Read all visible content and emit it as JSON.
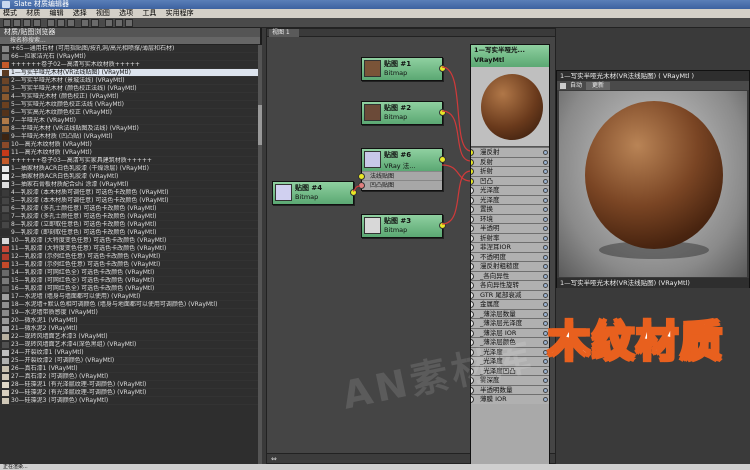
{
  "title": "Slate 材质编辑器",
  "menu": [
    "模式",
    "材质",
    "编辑",
    "选择",
    "视图",
    "选项",
    "工具",
    "实用程序"
  ],
  "browser": {
    "header": "材质/贴图浏览器",
    "search_placeholder": "按名称搜索...",
    "items": [
      {
        "label": "+65—通用石材 (可用指贴图/按孔洞/高光相喷撑/薄层和石材)",
        "color": "#888888"
      },
      {
        "label": "66—拉家洁光石 (VRayMtl)",
        "color": "#777777"
      },
      {
        "label": "++++++卷子02—高清写实木纹材质+++++",
        "color": "#c45a2a"
      },
      {
        "label": "1—写实半哑光木材(VR法线贴图) (VRayMtl)",
        "color": "#5a3a22"
      },
      {
        "label": "2—写实半哑光木材 (景城法线) (VRayMtl)",
        "color": "#6b4427"
      },
      {
        "label": "3—写实半哑光木材 (颜色校正法线) (VRayMtl)",
        "color": "#7a4d2a"
      },
      {
        "label": "4—写实哑光木材 (颜色校正) (VRayMtl)",
        "color": "#8a5a30"
      },
      {
        "label": "5—写实哑光木纹颜色校正法线 (VRayMtl)",
        "color": "#6a4020"
      },
      {
        "label": "6—写实高光木纹颜色校正 (VRayMtl)",
        "color": "#54331b"
      },
      {
        "label": "7—半哑光木 (VRayMtl)",
        "color": "#b07a48"
      },
      {
        "label": "8—半哑光木材 (VR法线贴图及法线) (VRayMtl)",
        "color": "#9a6a3c"
      },
      {
        "label": "9—半哑光木材质 (凹凸贴) (VRayMtl)",
        "color": "#3c2412"
      },
      {
        "label": "10—高光木纹材质 (VRayMtl)",
        "color": "#8a4a2a"
      },
      {
        "label": "11—高光木纹材质 (VRayMtl)",
        "color": "#c43a1a"
      },
      {
        "label": "++++++卷子03—高清写实家具建筑材质+++++",
        "color": "#c45a2a"
      },
      {
        "label": "1—抽家材质ACR白色乳胶漆 (干燥涂层) (VRayMtl)",
        "color": "#e8e8e8"
      },
      {
        "label": "2—抽家材质ACR白色乳胶漆 (VRayMtl)",
        "color": "#f0f0f0"
      },
      {
        "label": "3—抽家石膏板材质配合shi 涂漆 (VRayMtl)",
        "color": "#dcdcdc"
      },
      {
        "label": "4—乳胶漆 (本木材质可调任意) 可选色卡改颜色 (VRayMtl)",
        "color": "#3a3a3a"
      },
      {
        "label": "5—乳胶漆 (本木材质可调任意) 可选色卡改颜色 (VRayMtl)",
        "color": "#444444"
      },
      {
        "label": "6—乳胶漆 (多孔士颜任意) 可选色卡改颜色 (VRayMtl)",
        "color": "#505050"
      },
      {
        "label": "7—乳胶漆 (多孔士颜任意) 可选色卡改颜色 (VRayMtl)",
        "color": "#3c3c3c"
      },
      {
        "label": "8—乳胶漆 (立即取任意色) 可选色卡改颜色 (VRayMtl)",
        "color": "#464646"
      },
      {
        "label": "9—乳胶漆 (即刻取任意色) 可选色卡改颜色 (VRayMtl)",
        "color": "#2e2e2e"
      },
      {
        "label": "10—乳胶漆 (大特度变色任意) 可选色卡改颜色 (VRayMtl)",
        "color": "#d8d8d8"
      },
      {
        "label": "11—乳胶漆 (大特度变色任意) 可选色卡改颜色 (VRayMtl)",
        "color": "#c84a3a"
      },
      {
        "label": "12—乳胶漆 (示例红色任意) 可选色卡改颜色 (VRayMtl)",
        "color": "#b03a2a"
      },
      {
        "label": "13—乳胶漆 (示例红色任意) 可选色卡改颜色 (VRayMtl)",
        "color": "#c44a2a"
      },
      {
        "label": "14—乳胶漆 (可网红色全) 可选色卡改颜色 (VRayMtl)",
        "color": "#6a6a6a"
      },
      {
        "label": "15—乳胶漆 (可网红色全) 可选色卡改颜色 (VRayMtl)",
        "color": "#7a7a7a"
      },
      {
        "label": "16—乳胶漆 (可网红色全) 可选色卡改颜色 (VRayMtl)",
        "color": "#5a5a5a"
      },
      {
        "label": "17—水泥墙 (墙身与墙面都可以使用) (VRayMtl)",
        "color": "#a0a0a0"
      },
      {
        "label": "18—水泥墙+默认色相可调颜色 (墙身与地面都可以使用可调颜色) (VRayMtl)",
        "color": "#909090"
      },
      {
        "label": "19—水泥墙带质感度 (VRayMtl)",
        "color": "#8a8a8a"
      },
      {
        "label": "20—微水泥1 (VRayMtl)",
        "color": "#9a9a9a"
      },
      {
        "label": "21—微水泥2 (VRayMtl)",
        "color": "#aaaaaa"
      },
      {
        "label": "22—现砖风墙面艺术漆3 (VRayMtl)",
        "color": "#b8b0a0"
      },
      {
        "label": "23—现砖风墙面艺术漆4(深色黑组) (VRayMtl)",
        "color": "#505050"
      },
      {
        "label": "24—开裂纹漆1 (VRayMtl)",
        "color": "#c0c0c0"
      },
      {
        "label": "25—开裂纹漆2 (可调颜色) (VRayMtl)",
        "color": "#b0b0b0"
      },
      {
        "label": "26—真石漆1 (VRayMtl)",
        "color": "#c8c0b0"
      },
      {
        "label": "27—真石漆2 (可调颜色) (VRayMtl)",
        "color": "#d0c8b8"
      },
      {
        "label": "28—硅藻泥1 (有光泽腻纹理-可调颜色) (VRayMtl)",
        "color": "#e0d8c8"
      },
      {
        "label": "29—硅藻泥2 (有光泽腻纹理-可调颜色) (VRayMtl)",
        "color": "#d8d0c0"
      },
      {
        "label": "30—硅藻泥3 (可调颜色) (VRayMtl)",
        "color": "#cfc7b7"
      }
    ],
    "selected_index": 3
  },
  "canvas": {
    "tab": "视图 1",
    "nodes": [
      {
        "id": "map1",
        "title": "贴图 #1",
        "type": "Bitmap"
      },
      {
        "id": "map2",
        "title": "贴图 #2",
        "type": "Bitmap"
      },
      {
        "id": "map6",
        "title": "贴图 #6",
        "type": "VRay 法...",
        "slots": [
          "法线贴图",
          "凹凸贴图"
        ]
      },
      {
        "id": "map4",
        "title": "贴图 #4",
        "type": "Bitmap"
      },
      {
        "id": "map3",
        "title": "贴图 #3",
        "type": "Bitmap"
      }
    ],
    "material": {
      "title": "1—写实半哑光...",
      "type": "VRayMtl",
      "slots": [
        "漫反射",
        "反射",
        "折射",
        "凹凸",
        "光泽度",
        "光泽度",
        "置换",
        "环境",
        "半透明",
        "折射率",
        "菲涅耳IOR",
        "不透明度",
        "漫反射粗糙度",
        "_各向异性",
        "各向异性旋转",
        "GTR 尾部衰减",
        "金属度",
        "_薄涂层数量",
        "_薄涂层光泽度",
        "_薄涂层 IOR",
        "_薄涂层颜色",
        "_光泽度",
        "_光泽度",
        "_光泽度凹凸",
        "雾深度",
        "半透明数量",
        "薄膜 IOR"
      ],
      "connected_slots": [
        0,
        1,
        2,
        3
      ]
    }
  },
  "preview": {
    "title": "1—写实半哑光木材(VR法线贴图) ( VRayMtl )",
    "auto_label": "自动",
    "update_label": "更新",
    "footer": "1—写实半哑光木材(VR法线贴图) (VRayMtl)"
  },
  "promo_text": "木纹材质",
  "watermark": "AN素材库",
  "status": "正在渲染..."
}
